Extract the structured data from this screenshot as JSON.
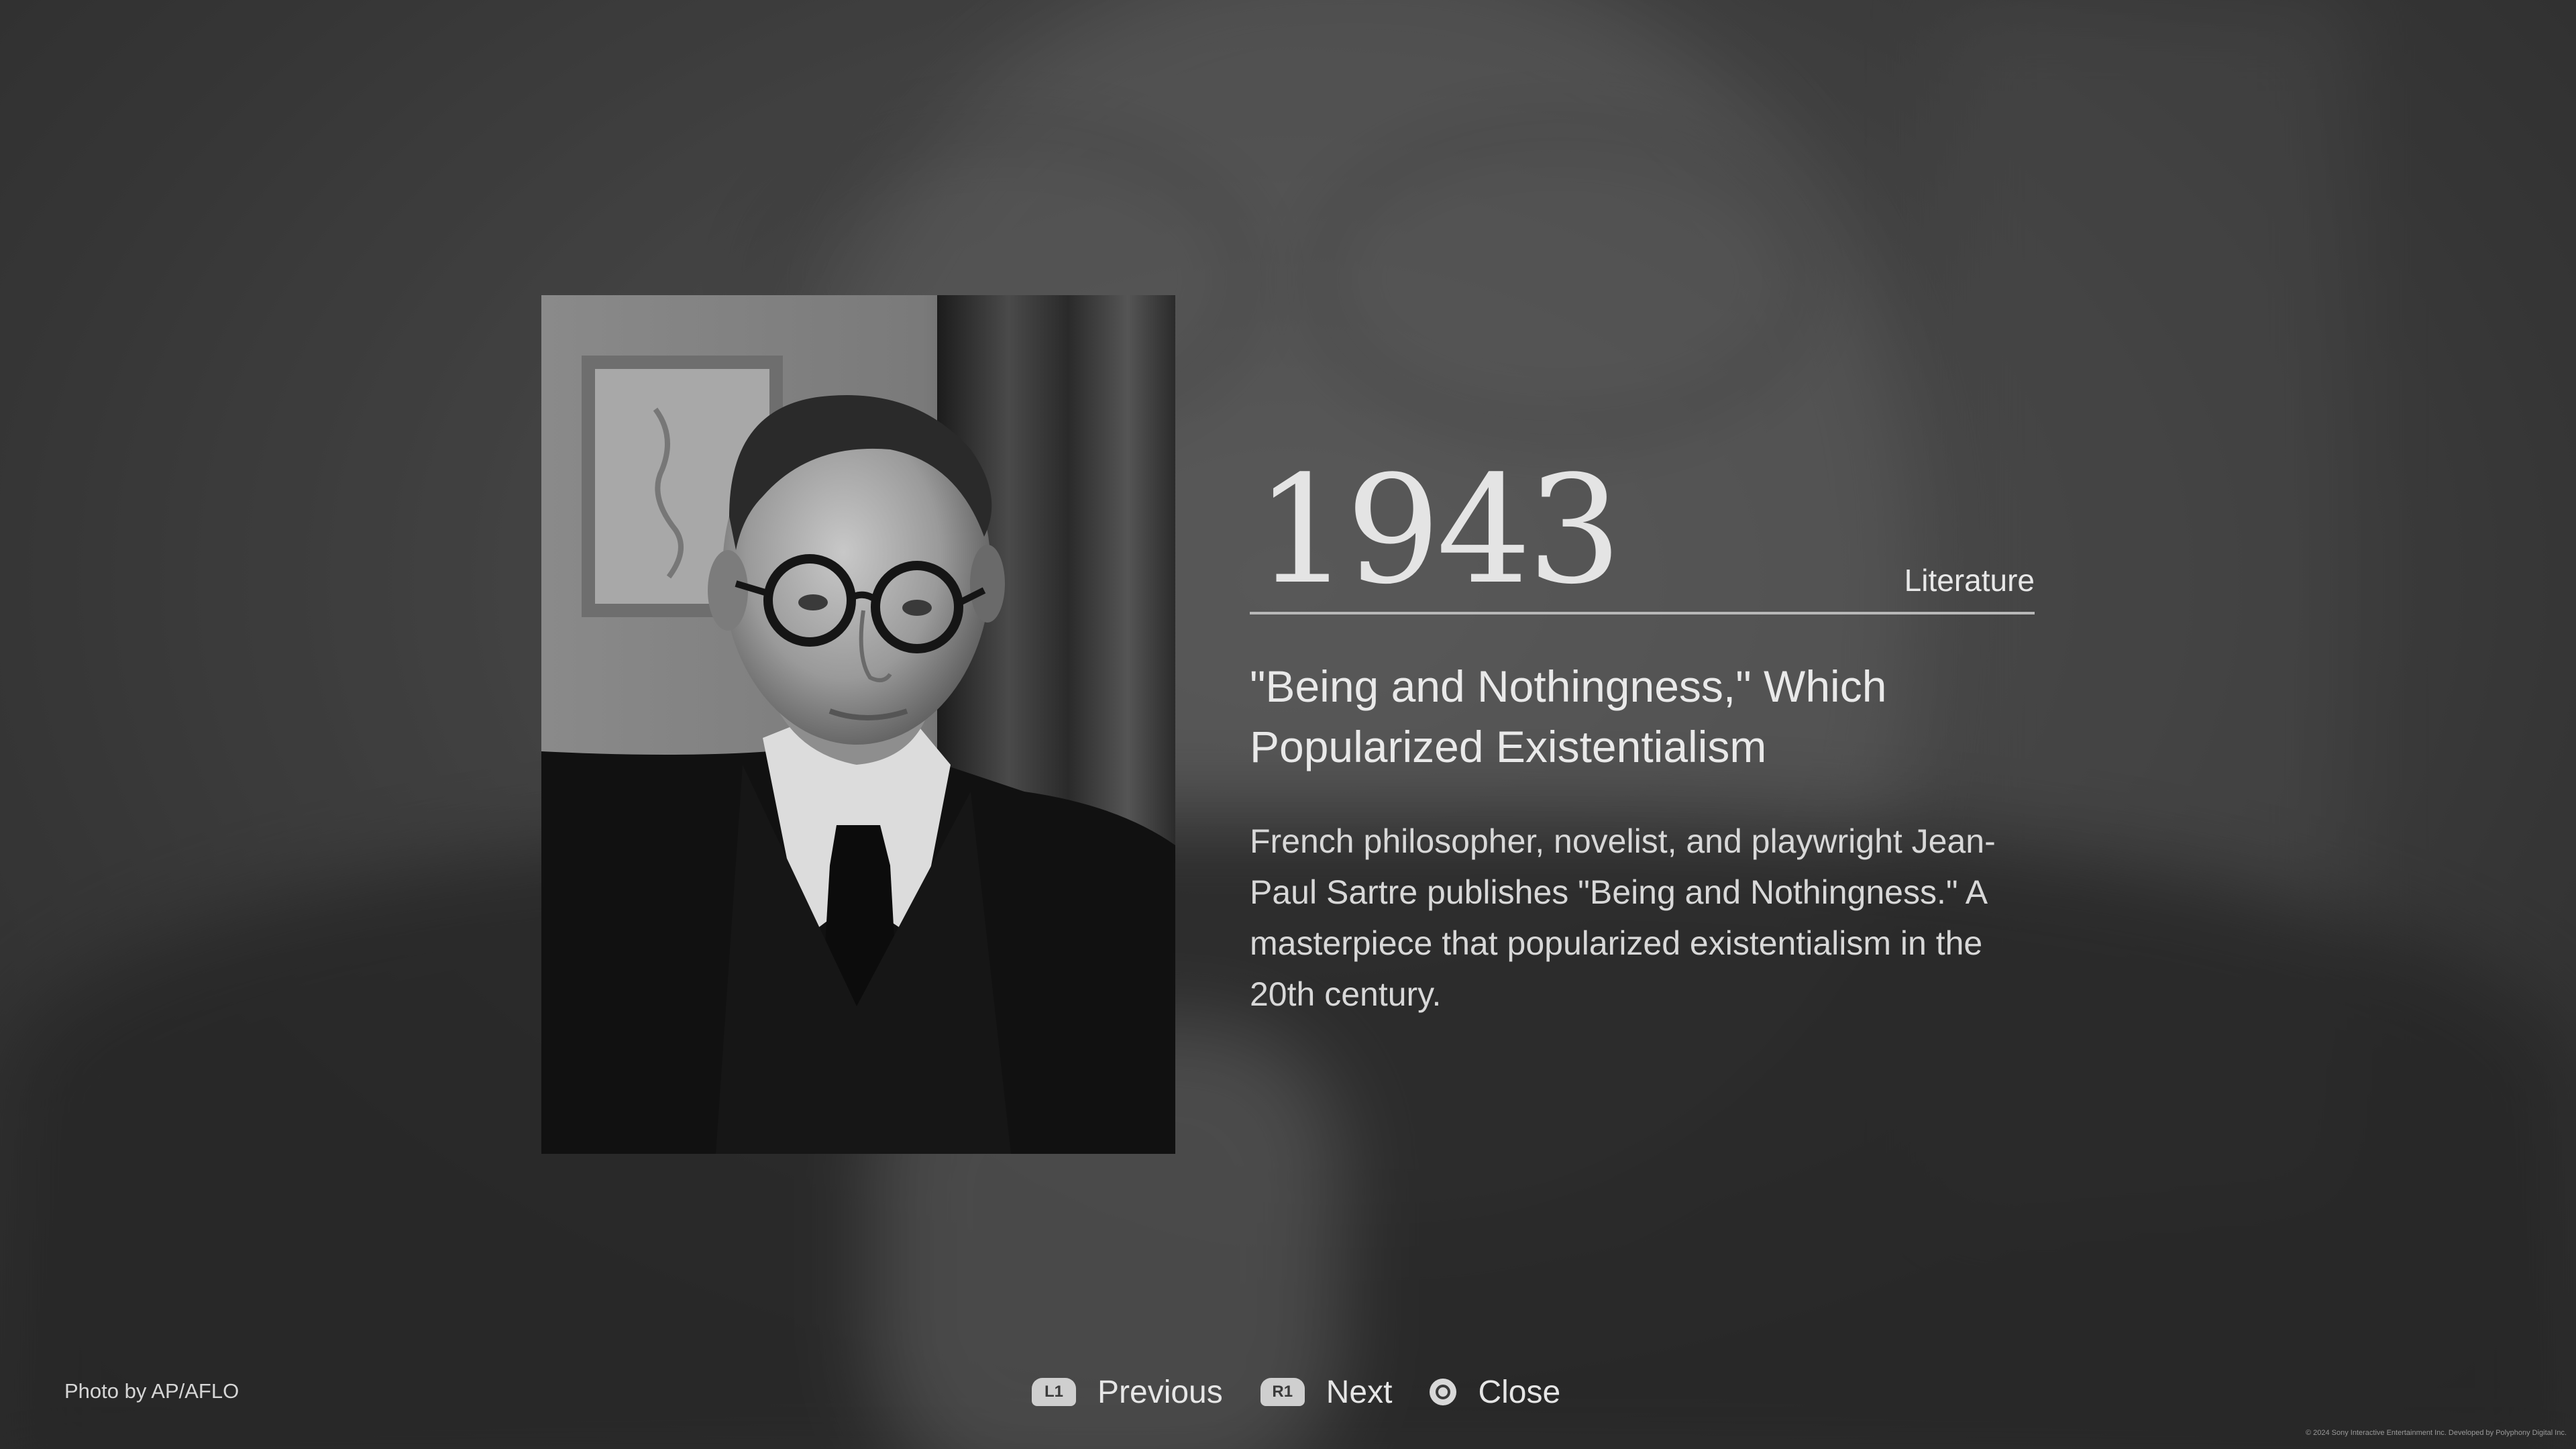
{
  "entry": {
    "year": "1943",
    "category": "Literature",
    "title": "\"Being and Nothingness,\" Which Popularized Existentialism",
    "description": "French philosopher, novelist, and playwright Jean-Paul Sartre publishes \"Being and Nothingness.\" A masterpiece that popularized existentialism in the 20th century."
  },
  "credits": {
    "photo": "Photo by AP/AFLO",
    "copyright": "© 2024 Sony Interactive Entertainment Inc. Developed by Polyphony Digital Inc."
  },
  "navigation": {
    "previous": {
      "button": "L1",
      "label": "Previous",
      "icon": "l1-button-icon"
    },
    "next": {
      "button": "R1",
      "label": "Next",
      "icon": "r1-button-icon"
    },
    "close": {
      "label": "Close",
      "icon": "circle-button-icon"
    }
  }
}
